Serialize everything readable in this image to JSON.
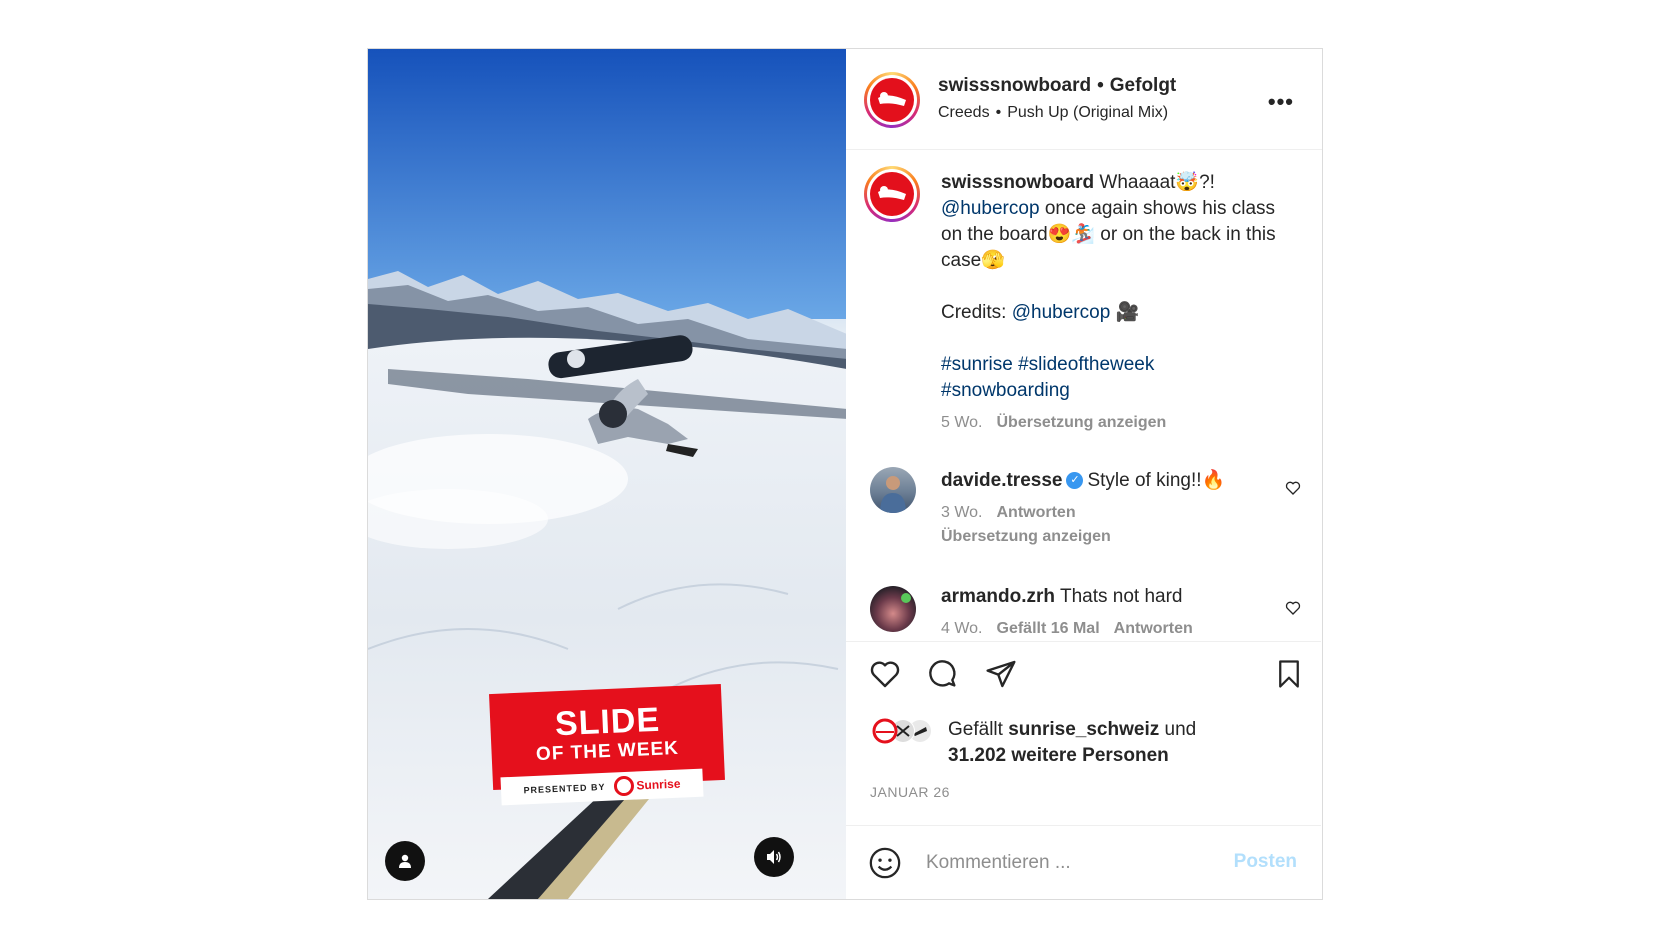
{
  "post": {
    "username": "swisssnowboard",
    "follow_status": "Gefolgt",
    "audio_artist": "Creeds",
    "audio_track": "Push Up (Original Mix)",
    "more_label": "•••"
  },
  "media": {
    "badge_line1": "SLIDE",
    "badge_line2": "OF THE WEEK",
    "badge_presented": "PRESENTED BY",
    "badge_brand": "Sunrise"
  },
  "caption": {
    "username": "swisssnowboard",
    "text_1": "Whaaaat🤯?!",
    "mention_1": "@hubercop",
    "text_2": "once again shows his class on the board😍🏂 or on the back in this case🫣",
    "credits_label": "Credits:",
    "mention_2": "@hubercop",
    "credits_emoji": "🎥",
    "hashtag_1": "#sunrise",
    "hashtag_2": "#slideoftheweek",
    "hashtag_3": "#snowboarding",
    "age": "5 Wo.",
    "translate": "Übersetzung anzeigen"
  },
  "comments": [
    {
      "username": "davide.tresse",
      "text": "Style of king!!🔥",
      "age": "3 Wo.",
      "reply": "Antworten",
      "translate": "Übersetzung anzeigen"
    },
    {
      "username": "armando.zrh",
      "text": "Thats not hard",
      "age": "4 Wo.",
      "likes": "Gefällt 16 Mal",
      "reply": "Antworten"
    }
  ],
  "likes": {
    "prefix": "Gefällt",
    "user": "sunrise_schweiz",
    "connector": "und",
    "others": "31.202 weitere Personen"
  },
  "date": "JANUAR 26",
  "composer": {
    "placeholder": "Kommentieren ...",
    "post_label": "Posten"
  },
  "colors": {
    "brand_red": "#e3101c",
    "link": "#00376b",
    "muted": "#8e8e8e",
    "post_button_disabled": "#b2dffc",
    "verified": "#3897f0"
  }
}
